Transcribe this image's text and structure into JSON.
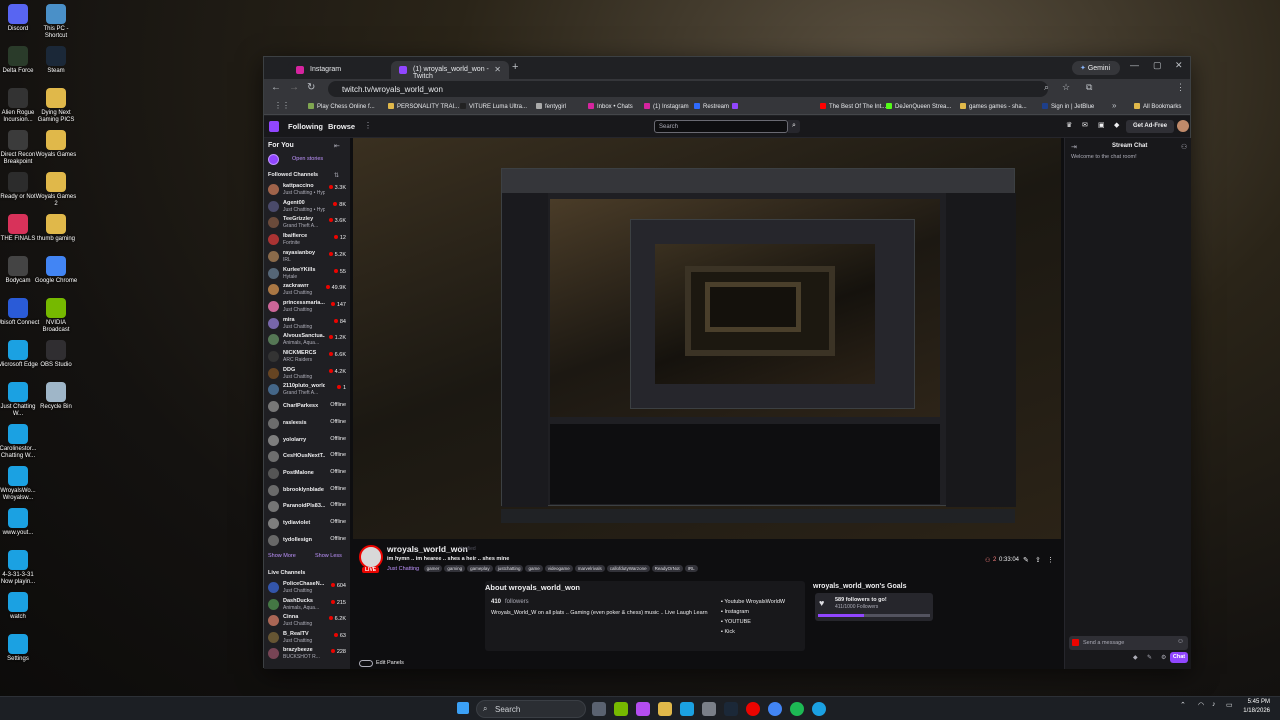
{
  "desktop_icons": [
    {
      "label": "Discord",
      "icon": "discord-icon",
      "color": "#5865f2"
    },
    {
      "label": "This PC - Shortcut",
      "icon": "pc-icon",
      "color": "#4a90c8"
    },
    {
      "label": "Delta Force",
      "icon": "game-icon",
      "color": "#2a3b2a"
    },
    {
      "label": "Steam",
      "icon": "steam-icon",
      "color": "#1b2838"
    },
    {
      "label": "Alien Rogue Incursion...",
      "icon": "game-icon",
      "color": "#333"
    },
    {
      "label": "Dying Next Gaming PICS",
      "icon": "folder-icon",
      "color": "#e0b84a"
    },
    {
      "label": "Direct Recon Breakpoint",
      "icon": "game-icon",
      "color": "#3b3b3b"
    },
    {
      "label": "Woyals Games",
      "icon": "folder-icon",
      "color": "#e0b84a"
    },
    {
      "label": "Ready or Not",
      "icon": "game-icon",
      "color": "#2c2c2c"
    },
    {
      "label": "Woyals Games 2",
      "icon": "folder-icon",
      "color": "#e0b84a"
    },
    {
      "label": "THE FINALS",
      "icon": "game-icon",
      "color": "#d8325a"
    },
    {
      "label": "thumb gaming",
      "icon": "folder-icon",
      "color": "#e0b84a"
    },
    {
      "label": "Bodycam",
      "icon": "game-icon",
      "color": "#444"
    },
    {
      "label": "Google Chrome",
      "icon": "chrome-icon",
      "color": "#4285f4"
    },
    {
      "label": "Ubisoft Connect",
      "icon": "ubisoft-icon",
      "color": "#2a5bd7"
    },
    {
      "label": "NVIDIA Broadcast",
      "icon": "nvidia-icon",
      "color": "#76b900"
    },
    {
      "label": "Microsoft Edge",
      "icon": "edge-icon",
      "color": "#1ba1e2"
    },
    {
      "label": "OBS Studio",
      "icon": "obs-icon",
      "color": "#302e31"
    },
    {
      "label": "Just Chatting W...",
      "icon": "edge-icon",
      "color": "#1ba1e2"
    },
    {
      "label": "Recycle Bin",
      "icon": "bin-icon",
      "color": "#9fb6c8"
    },
    {
      "label": "Carolinestor... Chatting W...",
      "icon": "edge-icon",
      "color": "#1ba1e2"
    },
    {
      "label": "WroyalsWo... Wroyalsw...",
      "icon": "edge-icon",
      "color": "#1ba1e2"
    },
    {
      "label": "www.yout...",
      "icon": "edge-icon",
      "color": "#1ba1e2"
    },
    {
      "label": "4-3-31-3-31 Now playin...",
      "icon": "edge-icon",
      "color": "#1ba1e2"
    },
    {
      "label": "watch",
      "icon": "edge-icon",
      "color": "#1ba1e2"
    },
    {
      "label": "Settings",
      "icon": "edge-icon",
      "color": "#1ba1e2"
    }
  ],
  "browser": {
    "tabs": [
      {
        "title": "Instagram",
        "icon": "instagram-icon",
        "color": "#d6249f",
        "active": false
      },
      {
        "title": "(1) wroyals_world_won - Twitch",
        "icon": "twitch-icon",
        "color": "#9146ff",
        "active": true
      }
    ],
    "new_tab": "+",
    "gemini": "Gemini",
    "url": "twitch.tv/wroyals_world_won",
    "bookmarks": [
      {
        "label": "Play Chess Online f...",
        "color": "#7fa650"
      },
      {
        "label": "PERSONALITY TRAI...",
        "color": "#e0b84a"
      },
      {
        "label": "VITURE Luma Ultra...",
        "color": "#222"
      },
      {
        "label": "fentygirl",
        "color": "#aaa"
      },
      {
        "label": "Inbox • Chats",
        "color": "#d6249f"
      },
      {
        "label": "(1) Instagram",
        "color": "#d6249f"
      },
      {
        "label": "Restream",
        "color": "#2f6bff"
      },
      {
        "label": "",
        "color": "#9146ff"
      },
      {
        "label": "The Best Of The Int...",
        "color": "#ff0000"
      },
      {
        "label": "DeJenQueen Strea...",
        "color": "#53fc18"
      },
      {
        "label": "games games - sha...",
        "color": "#e0b84a"
      },
      {
        "label": "Sign in | JetBlue",
        "color": "#1e3f8a"
      },
      {
        "label": "All Bookmarks",
        "color": "#e0b84a"
      }
    ]
  },
  "twitch": {
    "nav": {
      "following": "Following",
      "browse": "Browse",
      "search_placeholder": "Search",
      "get_ad_free": "Get Ad-Free"
    },
    "sidebar": {
      "for_you": "For You",
      "open_stories": "Open stories",
      "followed_label": "Followed Channels",
      "followed": [
        {
          "name": "kattpaccino",
          "game": "Just Chatting • Hype Train • Level 2",
          "viewers": "3.3K",
          "live": true,
          "color": "#a0634a"
        },
        {
          "name": "Agent00",
          "game": "Just Chatting • Hype Train • Level 2",
          "viewers": "8K",
          "live": true,
          "color": "#4a4a6a"
        },
        {
          "name": "TeeGrizzley",
          "game": "Grand Theft A...",
          "viewers": "3.6K",
          "live": true,
          "color": "#6a4a3a"
        },
        {
          "name": "Ibaifierce",
          "game": "Fortnite",
          "viewers": "12",
          "live": true,
          "color": "#aa3333"
        },
        {
          "name": "rayasianboy",
          "game": "IRL",
          "viewers": "5.2K",
          "live": true,
          "color": "#8a6a4a"
        },
        {
          "name": "KurleeYKills",
          "game": "Hytale",
          "viewers": "55",
          "live": true,
          "color": "#556677"
        },
        {
          "name": "zackrawrr",
          "game": "Just Chatting",
          "viewers": "49.9K",
          "live": true,
          "color": "#aa7744"
        },
        {
          "name": "princessmaria...",
          "game": "Just Chatting",
          "viewers": "147",
          "live": true,
          "color": "#cc6699"
        },
        {
          "name": "mira",
          "game": "Just Chatting",
          "viewers": "84",
          "live": true,
          "color": "#7766aa"
        },
        {
          "name": "AlvousSanctua...",
          "game": "Animals, Aqua...",
          "viewers": "1.2K",
          "live": true,
          "color": "#557755"
        },
        {
          "name": "NICKMERCS",
          "game": "ARC Raiders",
          "viewers": "6.6K",
          "live": true,
          "color": "#333333"
        },
        {
          "name": "DDG",
          "game": "Just Chatting",
          "viewers": "4.2K",
          "live": true,
          "color": "#664422"
        },
        {
          "name": "2110pluto_world",
          "game": "Grand Theft A...",
          "viewers": "1",
          "live": true,
          "color": "#446688"
        },
        {
          "name": "CharlParkesx",
          "game": "",
          "viewers": "Offline",
          "live": false,
          "color": "#777777"
        },
        {
          "name": "rasleesis",
          "game": "",
          "viewers": "Offline",
          "live": false,
          "color": "#886655"
        },
        {
          "name": "yololarry",
          "game": "",
          "viewers": "Offline",
          "live": false,
          "color": "#558899"
        },
        {
          "name": "CesHOusNextT...",
          "game": "",
          "viewers": "Offline",
          "live": false,
          "color": "#996644"
        },
        {
          "name": "PostMalone",
          "game": "",
          "viewers": "Offline",
          "live": false,
          "color": "#555555"
        },
        {
          "name": "bbrooklynblade",
          "game": "",
          "viewers": "Offline",
          "live": false,
          "color": "#aa5577"
        },
        {
          "name": "ParanoidPls83...",
          "game": "",
          "viewers": "Offline",
          "live": false,
          "color": "#667788"
        },
        {
          "name": "tydiaviolet",
          "game": "",
          "viewers": "Offline",
          "live": false,
          "color": "#8877aa"
        },
        {
          "name": "tydollesign",
          "game": "",
          "viewers": "Offline",
          "live": false,
          "color": "#776655"
        }
      ],
      "show_more": "Show More",
      "show_less": "Show Less",
      "live_label": "Live Channels",
      "live": [
        {
          "name": "PoliceChaseN...",
          "game": "Just Chatting",
          "viewers": "604",
          "color": "#3355aa"
        },
        {
          "name": "DashDucks",
          "game": "Animals, Aqua...",
          "viewers": "215",
          "color": "#447744"
        },
        {
          "name": "Cinna",
          "game": "Just Chatting",
          "viewers": "6.2K",
          "color": "#aa6655"
        },
        {
          "name": "B_RealTV",
          "game": "Just Chatting",
          "viewers": "63",
          "color": "#665533"
        },
        {
          "name": "brazybeeze",
          "game": "BUCKSHOT R...",
          "viewers": "228",
          "color": "#774455"
        }
      ]
    },
    "stream": {
      "channel": "wroyals_world_won",
      "badge": "Verified",
      "title": "im hymn .. im hearee .. shes a heir .. shes mine",
      "category": "Just Chatting",
      "tags": [
        "gamer",
        "gaming",
        "gameplay",
        "justchatting",
        "game",
        "videogame",
        "marvelrivals",
        "callofdutyWarzone",
        "ReadyOrNot",
        "IRL"
      ],
      "viewers": "2",
      "uptime": "0:33:04",
      "about_title": "About wroyals_world_won",
      "followers": "410",
      "followers_label": "followers",
      "bio": "Wroyals_World_W on all plats .. Gaming (even poker & chess) music .. Live Laugh Learn",
      "socials": [
        {
          "label": "Youtube WroyalsWorldW",
          "icon": "youtube-icon"
        },
        {
          "label": "Instagram",
          "icon": "instagram-icon"
        },
        {
          "label": "YOUTUBE",
          "icon": "youtube-icon"
        },
        {
          "label": "Kick",
          "icon": "kick-icon"
        }
      ],
      "goals_title": "wroyals_world_won's Goals",
      "goal_text": "589 followers to go!",
      "goal_progress": "411/1000 Followers",
      "goal_fraction": 0.411,
      "edit_panels": "Edit Panels"
    },
    "chat": {
      "title": "Stream Chat",
      "welcome": "Welcome to the chat room!",
      "placeholder": "Send a message",
      "chat_button": "Chat"
    }
  },
  "taskbar": {
    "search": "Search",
    "time": "5:45 PM",
    "date": "1/18/2026"
  }
}
